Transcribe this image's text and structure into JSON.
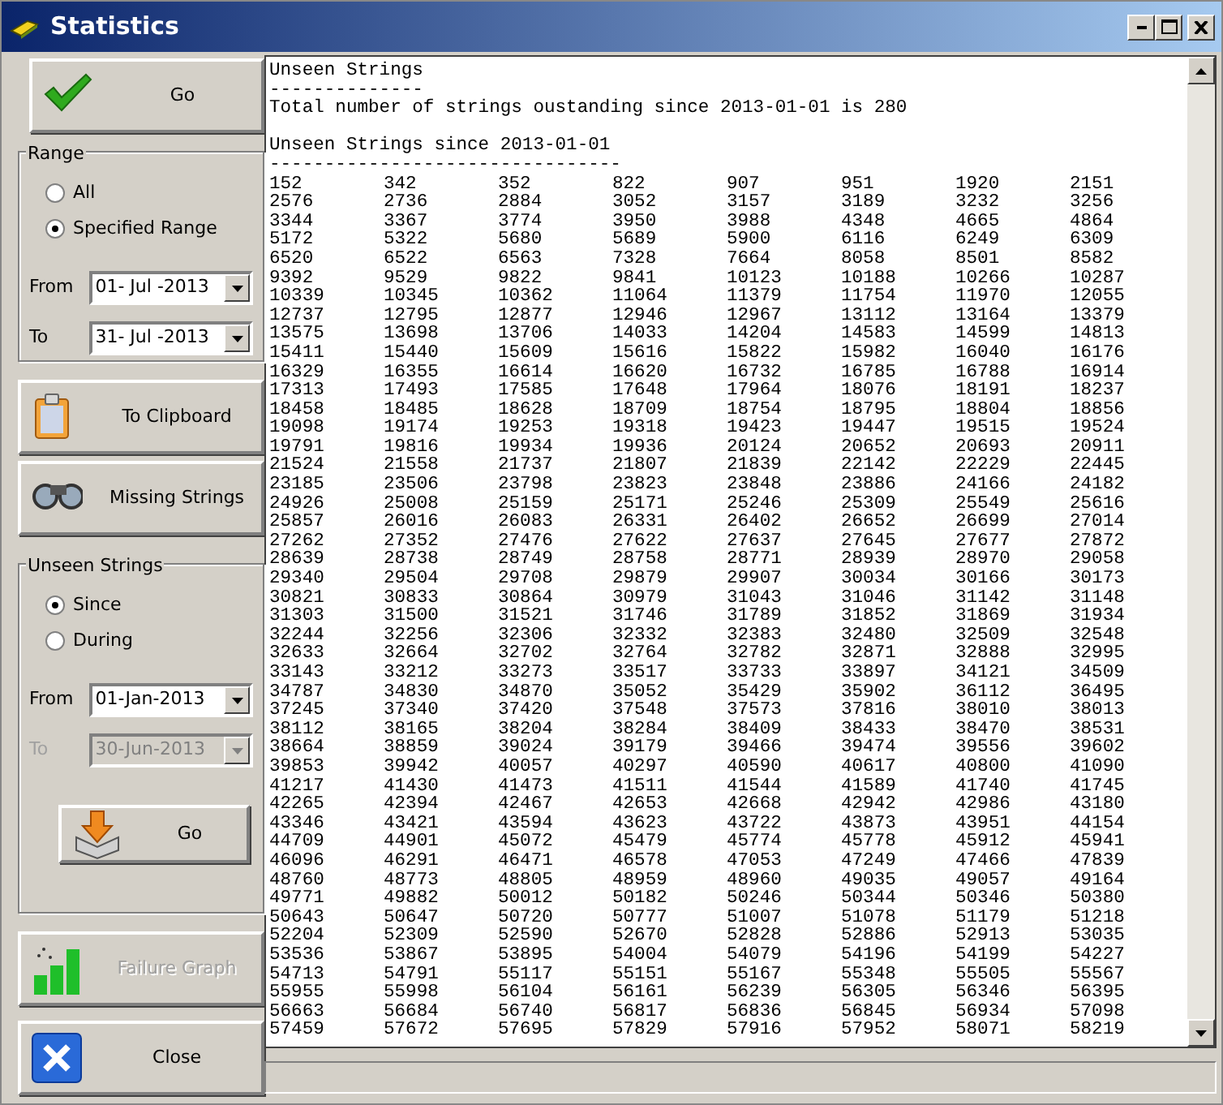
{
  "window": {
    "title": "Statistics"
  },
  "go_button": {
    "label": "Go",
    "disabled": false
  },
  "range_group": {
    "title": "Range",
    "options": [
      {
        "label": "All",
        "selected": false
      },
      {
        "label": "Specified Range",
        "selected": true
      }
    ],
    "from": {
      "label": "From",
      "value": "01- Jul -2013",
      "disabled": false
    },
    "to": {
      "label": "To",
      "value": "31- Jul -2013",
      "disabled": false
    }
  },
  "clipboard_button": {
    "label": "To Clipboard",
    "disabled": false
  },
  "missing_button": {
    "label": "Missing Strings",
    "disabled": false
  },
  "unseen_group": {
    "title": "Unseen Strings",
    "options": [
      {
        "label": "Since",
        "selected": true
      },
      {
        "label": "During",
        "selected": false
      }
    ],
    "from": {
      "label": "From",
      "value": "01-Jan-2013",
      "disabled": false
    },
    "to": {
      "label": "To",
      "value": "30-Jun-2013",
      "disabled": true
    },
    "go_button": {
      "label": "Go",
      "disabled": false
    }
  },
  "graph_button": {
    "label": "Failure Graph",
    "disabled": true
  },
  "close_button": {
    "label": "Close",
    "disabled": false
  },
  "output": {
    "title": "Unseen Strings",
    "title_rule": "--------------",
    "summary": "Total number of strings oustanding since 2013-01-01 is 280",
    "subtitle": "Unseen Strings since 2013-01-01",
    "subtitle_rule": "--------------------------------",
    "rows": [
      [
        "152",
        "342",
        "352",
        "822",
        "907",
        "951",
        "1920",
        "2151"
      ],
      [
        "2576",
        "2736",
        "2884",
        "3052",
        "3157",
        "3189",
        "3232",
        "3256"
      ],
      [
        "3344",
        "3367",
        "3774",
        "3950",
        "3988",
        "4348",
        "4665",
        "4864"
      ],
      [
        "5172",
        "5322",
        "5680",
        "5689",
        "5900",
        "6116",
        "6249",
        "6309"
      ],
      [
        "6520",
        "6522",
        "6563",
        "7328",
        "7664",
        "8058",
        "8501",
        "8582"
      ],
      [
        "9392",
        "9529",
        "9822",
        "9841",
        "10123",
        "10188",
        "10266",
        "10287"
      ],
      [
        "10339",
        "10345",
        "10362",
        "11064",
        "11379",
        "11754",
        "11970",
        "12055"
      ],
      [
        "12737",
        "12795",
        "12877",
        "12946",
        "12967",
        "13112",
        "13164",
        "13379"
      ],
      [
        "13575",
        "13698",
        "13706",
        "14033",
        "14204",
        "14583",
        "14599",
        "14813"
      ],
      [
        "15411",
        "15440",
        "15609",
        "15616",
        "15822",
        "15982",
        "16040",
        "16176"
      ],
      [
        "16329",
        "16355",
        "16614",
        "16620",
        "16732",
        "16785",
        "16788",
        "16914"
      ],
      [
        "17313",
        "17493",
        "17585",
        "17648",
        "17964",
        "18076",
        "18191",
        "18237"
      ],
      [
        "18458",
        "18485",
        "18628",
        "18709",
        "18754",
        "18795",
        "18804",
        "18856"
      ],
      [
        "19098",
        "19174",
        "19253",
        "19318",
        "19423",
        "19447",
        "19515",
        "19524"
      ],
      [
        "19791",
        "19816",
        "19934",
        "19936",
        "20124",
        "20652",
        "20693",
        "20911"
      ],
      [
        "21524",
        "21558",
        "21737",
        "21807",
        "21839",
        "22142",
        "22229",
        "22445"
      ],
      [
        "23185",
        "23506",
        "23798",
        "23823",
        "23848",
        "23886",
        "24166",
        "24182"
      ],
      [
        "24926",
        "25008",
        "25159",
        "25171",
        "25246",
        "25309",
        "25549",
        "25616"
      ],
      [
        "25857",
        "26016",
        "26083",
        "26331",
        "26402",
        "26652",
        "26699",
        "27014"
      ],
      [
        "27262",
        "27352",
        "27476",
        "27622",
        "27637",
        "27645",
        "27677",
        "27872"
      ],
      [
        "28639",
        "28738",
        "28749",
        "28758",
        "28771",
        "28939",
        "28970",
        "29058"
      ],
      [
        "29340",
        "29504",
        "29708",
        "29879",
        "29907",
        "30034",
        "30166",
        "30173"
      ],
      [
        "30821",
        "30833",
        "30864",
        "30979",
        "31043",
        "31046",
        "31142",
        "31148"
      ],
      [
        "31303",
        "31500",
        "31521",
        "31746",
        "31789",
        "31852",
        "31869",
        "31934"
      ],
      [
        "32244",
        "32256",
        "32306",
        "32332",
        "32383",
        "32480",
        "32509",
        "32548"
      ],
      [
        "32633",
        "32664",
        "32702",
        "32764",
        "32782",
        "32871",
        "32888",
        "32995"
      ],
      [
        "33143",
        "33212",
        "33273",
        "33517",
        "33733",
        "33897",
        "34121",
        "34509"
      ],
      [
        "34787",
        "34830",
        "34870",
        "35052",
        "35429",
        "35902",
        "36112",
        "36495"
      ],
      [
        "37245",
        "37340",
        "37420",
        "37548",
        "37573",
        "37816",
        "38010",
        "38013"
      ],
      [
        "38112",
        "38165",
        "38204",
        "38284",
        "38409",
        "38433",
        "38470",
        "38531"
      ],
      [
        "38664",
        "38859",
        "39024",
        "39179",
        "39466",
        "39474",
        "39556",
        "39602"
      ],
      [
        "39853",
        "39942",
        "40057",
        "40297",
        "40590",
        "40617",
        "40800",
        "41090"
      ],
      [
        "41217",
        "41430",
        "41473",
        "41511",
        "41544",
        "41589",
        "41740",
        "41745"
      ],
      [
        "42265",
        "42394",
        "42467",
        "42653",
        "42668",
        "42942",
        "42986",
        "43180"
      ],
      [
        "43346",
        "43421",
        "43594",
        "43623",
        "43722",
        "43873",
        "43951",
        "44154"
      ],
      [
        "44709",
        "44901",
        "45072",
        "45479",
        "45774",
        "45778",
        "45912",
        "45941"
      ],
      [
        "46096",
        "46291",
        "46471",
        "46578",
        "47053",
        "47249",
        "47466",
        "47839"
      ],
      [
        "48760",
        "48773",
        "48805",
        "48959",
        "48960",
        "49035",
        "49057",
        "49164"
      ],
      [
        "49771",
        "49882",
        "50012",
        "50182",
        "50246",
        "50344",
        "50346",
        "50380"
      ],
      [
        "50643",
        "50647",
        "50720",
        "50777",
        "51007",
        "51078",
        "51179",
        "51218"
      ],
      [
        "52204",
        "52309",
        "52590",
        "52670",
        "52828",
        "52886",
        "52913",
        "53035"
      ],
      [
        "53536",
        "53867",
        "53895",
        "54004",
        "54079",
        "54196",
        "54199",
        "54227"
      ],
      [
        "54713",
        "54791",
        "55117",
        "55151",
        "55167",
        "55348",
        "55505",
        "55567"
      ],
      [
        "55955",
        "55998",
        "56104",
        "56161",
        "56239",
        "56305",
        "56346",
        "56395"
      ],
      [
        "56663",
        "56684",
        "56740",
        "56817",
        "56836",
        "56845",
        "56934",
        "57098"
      ],
      [
        "57459",
        "57672",
        "57695",
        "57829",
        "57916",
        "57952",
        "58071",
        "58219"
      ]
    ]
  }
}
